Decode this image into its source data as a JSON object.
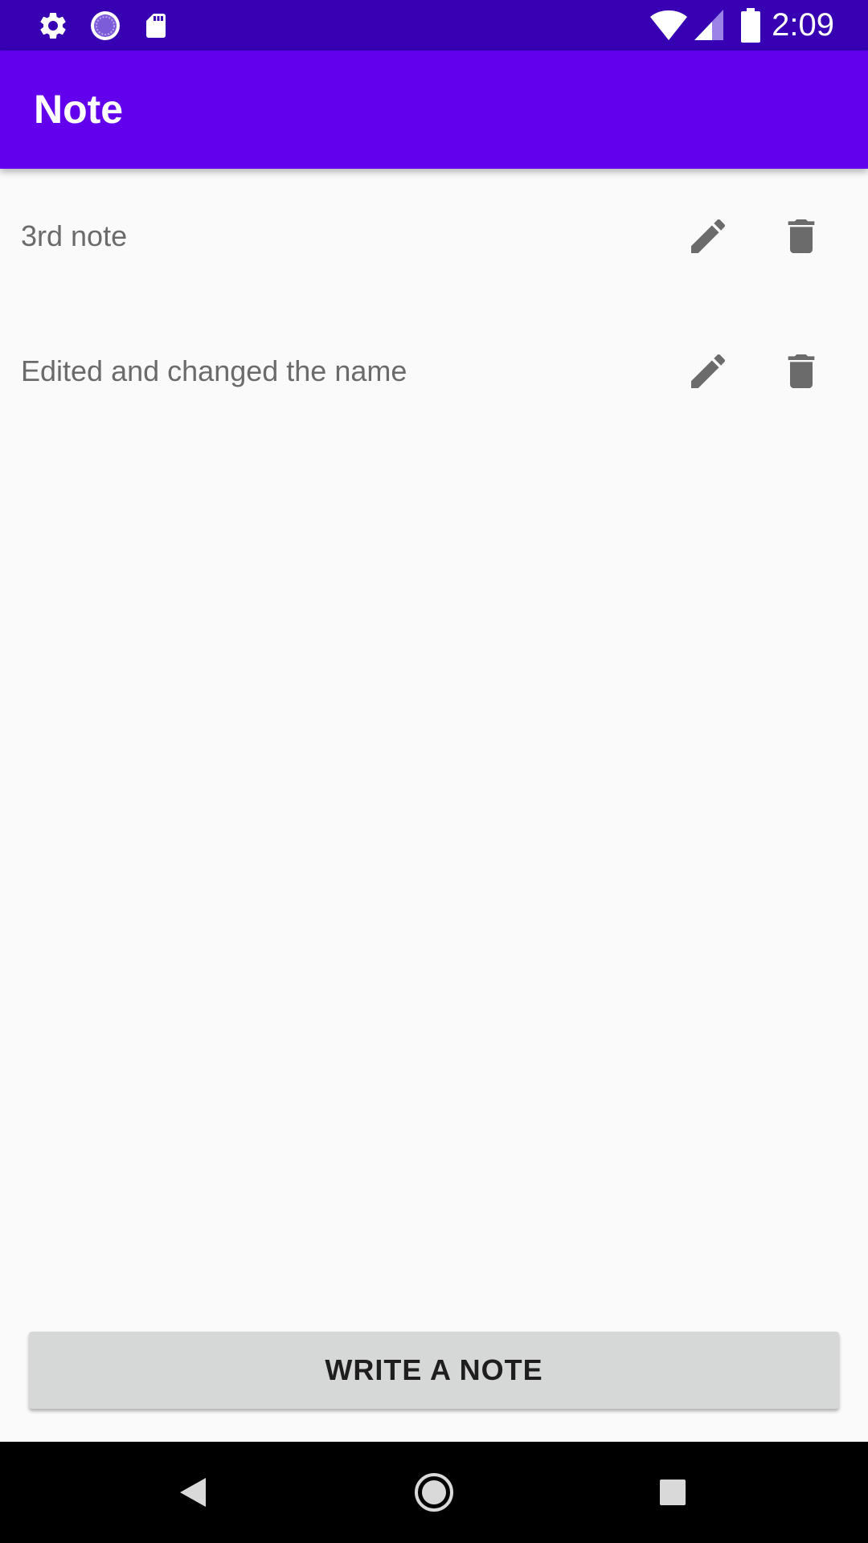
{
  "status_bar": {
    "time": "2:09",
    "left_icons": [
      "gear-icon",
      "loading-icon",
      "sd-card-icon"
    ],
    "right_icons": [
      "wifi-icon",
      "cell-signal-icon",
      "battery-icon"
    ]
  },
  "app_bar": {
    "title": "Note"
  },
  "notes": [
    {
      "text": "3rd note",
      "edit_icon": "pencil-icon",
      "delete_icon": "trash-icon"
    },
    {
      "text": "Edited and changed the name",
      "edit_icon": "pencil-icon",
      "delete_icon": "trash-icon"
    }
  ],
  "write_button": {
    "label": "WRITE A NOTE"
  },
  "nav_bar": {
    "icons": [
      "back-icon",
      "home-icon",
      "recents-icon"
    ]
  },
  "colors": {
    "status_bar": "#3700b3",
    "app_bar": "#6200ee",
    "background": "#fafafa",
    "icon": "#6b6b6b",
    "button_bg": "#d6d7d7"
  }
}
